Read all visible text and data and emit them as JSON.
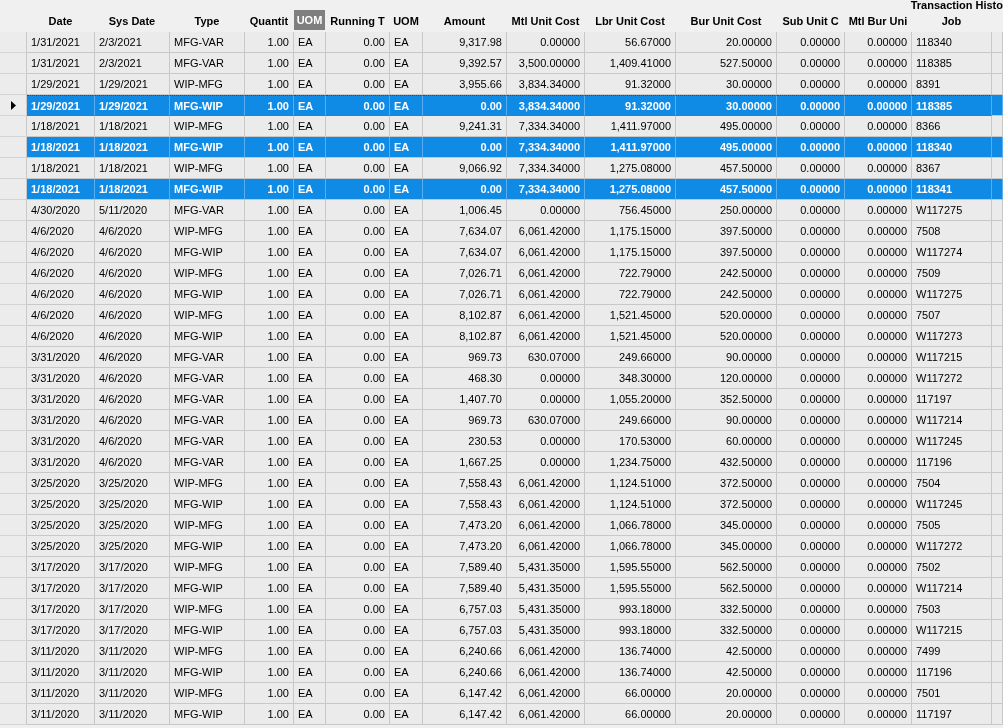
{
  "title": "Transaction Histo",
  "columns": [
    {
      "label": "Date",
      "highlighted": false
    },
    {
      "label": "Sys Date",
      "highlighted": false
    },
    {
      "label": "Type",
      "highlighted": false
    },
    {
      "label": "Quantit",
      "highlighted": false
    },
    {
      "label": "UOM",
      "highlighted": true
    },
    {
      "label": "Running T",
      "highlighted": false
    },
    {
      "label": "UOM",
      "highlighted": false
    },
    {
      "label": "Amount",
      "highlighted": false
    },
    {
      "label": "Mtl Unit Cost",
      "highlighted": false
    },
    {
      "label": "Lbr Unit Cost",
      "highlighted": false
    },
    {
      "label": "Bur Unit Cost",
      "highlighted": false
    },
    {
      "label": "Sub Unit C",
      "highlighted": false
    },
    {
      "label": "Mtl Bur Uni",
      "highlighted": false
    },
    {
      "label": "Job",
      "highlighted": false
    }
  ],
  "rows": [
    {
      "current": false,
      "selected": false,
      "cells": [
        "1/31/2021",
        "2/3/2021",
        "MFG-VAR",
        "1.00",
        "EA",
        "0.00",
        "EA",
        "9,317.98",
        "0.00000",
        "56.67000",
        "20.00000",
        "0.00000",
        "0.00000",
        "118340"
      ]
    },
    {
      "current": false,
      "selected": false,
      "cells": [
        "1/31/2021",
        "2/3/2021",
        "MFG-VAR",
        "1.00",
        "EA",
        "0.00",
        "EA",
        "9,392.57",
        "3,500.00000",
        "1,409.41000",
        "527.50000",
        "0.00000",
        "0.00000",
        "118385"
      ]
    },
    {
      "current": false,
      "selected": false,
      "cells": [
        "1/29/2021",
        "1/29/2021",
        "WIP-MFG",
        "1.00",
        "EA",
        "0.00",
        "EA",
        "3,955.66",
        "3,834.34000",
        "91.32000",
        "30.00000",
        "0.00000",
        "0.00000",
        "8391"
      ]
    },
    {
      "current": true,
      "selected": true,
      "cells": [
        "1/29/2021",
        "1/29/2021",
        "MFG-WIP",
        "1.00",
        "EA",
        "0.00",
        "EA",
        "0.00",
        "3,834.34000",
        "91.32000",
        "30.00000",
        "0.00000",
        "0.00000",
        "118385"
      ]
    },
    {
      "current": false,
      "selected": false,
      "cells": [
        "1/18/2021",
        "1/18/2021",
        "WIP-MFG",
        "1.00",
        "EA",
        "0.00",
        "EA",
        "9,241.31",
        "7,334.34000",
        "1,411.97000",
        "495.00000",
        "0.00000",
        "0.00000",
        "8366"
      ]
    },
    {
      "current": false,
      "selected": true,
      "cells": [
        "1/18/2021",
        "1/18/2021",
        "MFG-WIP",
        "1.00",
        "EA",
        "0.00",
        "EA",
        "0.00",
        "7,334.34000",
        "1,411.97000",
        "495.00000",
        "0.00000",
        "0.00000",
        "118340"
      ]
    },
    {
      "current": false,
      "selected": false,
      "cells": [
        "1/18/2021",
        "1/18/2021",
        "WIP-MFG",
        "1.00",
        "EA",
        "0.00",
        "EA",
        "9,066.92",
        "7,334.34000",
        "1,275.08000",
        "457.50000",
        "0.00000",
        "0.00000",
        "8367"
      ]
    },
    {
      "current": false,
      "selected": true,
      "cells": [
        "1/18/2021",
        "1/18/2021",
        "MFG-WIP",
        "1.00",
        "EA",
        "0.00",
        "EA",
        "0.00",
        "7,334.34000",
        "1,275.08000",
        "457.50000",
        "0.00000",
        "0.00000",
        "118341"
      ]
    },
    {
      "current": false,
      "selected": false,
      "cells": [
        "4/30/2020",
        "5/11/2020",
        "MFG-VAR",
        "1.00",
        "EA",
        "0.00",
        "EA",
        "1,006.45",
        "0.00000",
        "756.45000",
        "250.00000",
        "0.00000",
        "0.00000",
        "W117275"
      ]
    },
    {
      "current": false,
      "selected": false,
      "cells": [
        "4/6/2020",
        "4/6/2020",
        "WIP-MFG",
        "1.00",
        "EA",
        "0.00",
        "EA",
        "7,634.07",
        "6,061.42000",
        "1,175.15000",
        "397.50000",
        "0.00000",
        "0.00000",
        "7508"
      ]
    },
    {
      "current": false,
      "selected": false,
      "cells": [
        "4/6/2020",
        "4/6/2020",
        "MFG-WIP",
        "1.00",
        "EA",
        "0.00",
        "EA",
        "7,634.07",
        "6,061.42000",
        "1,175.15000",
        "397.50000",
        "0.00000",
        "0.00000",
        "W117274"
      ]
    },
    {
      "current": false,
      "selected": false,
      "cells": [
        "4/6/2020",
        "4/6/2020",
        "WIP-MFG",
        "1.00",
        "EA",
        "0.00",
        "EA",
        "7,026.71",
        "6,061.42000",
        "722.79000",
        "242.50000",
        "0.00000",
        "0.00000",
        "7509"
      ]
    },
    {
      "current": false,
      "selected": false,
      "cells": [
        "4/6/2020",
        "4/6/2020",
        "MFG-WIP",
        "1.00",
        "EA",
        "0.00",
        "EA",
        "7,026.71",
        "6,061.42000",
        "722.79000",
        "242.50000",
        "0.00000",
        "0.00000",
        "W117275"
      ]
    },
    {
      "current": false,
      "selected": false,
      "cells": [
        "4/6/2020",
        "4/6/2020",
        "WIP-MFG",
        "1.00",
        "EA",
        "0.00",
        "EA",
        "8,102.87",
        "6,061.42000",
        "1,521.45000",
        "520.00000",
        "0.00000",
        "0.00000",
        "7507"
      ]
    },
    {
      "current": false,
      "selected": false,
      "cells": [
        "4/6/2020",
        "4/6/2020",
        "MFG-WIP",
        "1.00",
        "EA",
        "0.00",
        "EA",
        "8,102.87",
        "6,061.42000",
        "1,521.45000",
        "520.00000",
        "0.00000",
        "0.00000",
        "W117273"
      ]
    },
    {
      "current": false,
      "selected": false,
      "cells": [
        "3/31/2020",
        "4/6/2020",
        "MFG-VAR",
        "1.00",
        "EA",
        "0.00",
        "EA",
        "969.73",
        "630.07000",
        "249.66000",
        "90.00000",
        "0.00000",
        "0.00000",
        "W117215"
      ]
    },
    {
      "current": false,
      "selected": false,
      "cells": [
        "3/31/2020",
        "4/6/2020",
        "MFG-VAR",
        "1.00",
        "EA",
        "0.00",
        "EA",
        "468.30",
        "0.00000",
        "348.30000",
        "120.00000",
        "0.00000",
        "0.00000",
        "W117272"
      ]
    },
    {
      "current": false,
      "selected": false,
      "cells": [
        "3/31/2020",
        "4/6/2020",
        "MFG-VAR",
        "1.00",
        "EA",
        "0.00",
        "EA",
        "1,407.70",
        "0.00000",
        "1,055.20000",
        "352.50000",
        "0.00000",
        "0.00000",
        "117197"
      ]
    },
    {
      "current": false,
      "selected": false,
      "cells": [
        "3/31/2020",
        "4/6/2020",
        "MFG-VAR",
        "1.00",
        "EA",
        "0.00",
        "EA",
        "969.73",
        "630.07000",
        "249.66000",
        "90.00000",
        "0.00000",
        "0.00000",
        "W117214"
      ]
    },
    {
      "current": false,
      "selected": false,
      "cells": [
        "3/31/2020",
        "4/6/2020",
        "MFG-VAR",
        "1.00",
        "EA",
        "0.00",
        "EA",
        "230.53",
        "0.00000",
        "170.53000",
        "60.00000",
        "0.00000",
        "0.00000",
        "W117245"
      ]
    },
    {
      "current": false,
      "selected": false,
      "cells": [
        "3/31/2020",
        "4/6/2020",
        "MFG-VAR",
        "1.00",
        "EA",
        "0.00",
        "EA",
        "1,667.25",
        "0.00000",
        "1,234.75000",
        "432.50000",
        "0.00000",
        "0.00000",
        "117196"
      ]
    },
    {
      "current": false,
      "selected": false,
      "cells": [
        "3/25/2020",
        "3/25/2020",
        "WIP-MFG",
        "1.00",
        "EA",
        "0.00",
        "EA",
        "7,558.43",
        "6,061.42000",
        "1,124.51000",
        "372.50000",
        "0.00000",
        "0.00000",
        "7504"
      ]
    },
    {
      "current": false,
      "selected": false,
      "cells": [
        "3/25/2020",
        "3/25/2020",
        "MFG-WIP",
        "1.00",
        "EA",
        "0.00",
        "EA",
        "7,558.43",
        "6,061.42000",
        "1,124.51000",
        "372.50000",
        "0.00000",
        "0.00000",
        "W117245"
      ]
    },
    {
      "current": false,
      "selected": false,
      "cells": [
        "3/25/2020",
        "3/25/2020",
        "WIP-MFG",
        "1.00",
        "EA",
        "0.00",
        "EA",
        "7,473.20",
        "6,061.42000",
        "1,066.78000",
        "345.00000",
        "0.00000",
        "0.00000",
        "7505"
      ]
    },
    {
      "current": false,
      "selected": false,
      "cells": [
        "3/25/2020",
        "3/25/2020",
        "MFG-WIP",
        "1.00",
        "EA",
        "0.00",
        "EA",
        "7,473.20",
        "6,061.42000",
        "1,066.78000",
        "345.00000",
        "0.00000",
        "0.00000",
        "W117272"
      ]
    },
    {
      "current": false,
      "selected": false,
      "cells": [
        "3/17/2020",
        "3/17/2020",
        "WIP-MFG",
        "1.00",
        "EA",
        "0.00",
        "EA",
        "7,589.40",
        "5,431.35000",
        "1,595.55000",
        "562.50000",
        "0.00000",
        "0.00000",
        "7502"
      ]
    },
    {
      "current": false,
      "selected": false,
      "cells": [
        "3/17/2020",
        "3/17/2020",
        "MFG-WIP",
        "1.00",
        "EA",
        "0.00",
        "EA",
        "7,589.40",
        "5,431.35000",
        "1,595.55000",
        "562.50000",
        "0.00000",
        "0.00000",
        "W117214"
      ]
    },
    {
      "current": false,
      "selected": false,
      "cells": [
        "3/17/2020",
        "3/17/2020",
        "WIP-MFG",
        "1.00",
        "EA",
        "0.00",
        "EA",
        "6,757.03",
        "5,431.35000",
        "993.18000",
        "332.50000",
        "0.00000",
        "0.00000",
        "7503"
      ]
    },
    {
      "current": false,
      "selected": false,
      "cells": [
        "3/17/2020",
        "3/17/2020",
        "MFG-WIP",
        "1.00",
        "EA",
        "0.00",
        "EA",
        "6,757.03",
        "5,431.35000",
        "993.18000",
        "332.50000",
        "0.00000",
        "0.00000",
        "W117215"
      ]
    },
    {
      "current": false,
      "selected": false,
      "cells": [
        "3/11/2020",
        "3/11/2020",
        "WIP-MFG",
        "1.00",
        "EA",
        "0.00",
        "EA",
        "6,240.66",
        "6,061.42000",
        "136.74000",
        "42.50000",
        "0.00000",
        "0.00000",
        "7499"
      ]
    },
    {
      "current": false,
      "selected": false,
      "cells": [
        "3/11/2020",
        "3/11/2020",
        "MFG-WIP",
        "1.00",
        "EA",
        "0.00",
        "EA",
        "6,240.66",
        "6,061.42000",
        "136.74000",
        "42.50000",
        "0.00000",
        "0.00000",
        "117196"
      ]
    },
    {
      "current": false,
      "selected": false,
      "cells": [
        "3/11/2020",
        "3/11/2020",
        "WIP-MFG",
        "1.00",
        "EA",
        "0.00",
        "EA",
        "6,147.42",
        "6,061.42000",
        "66.00000",
        "20.00000",
        "0.00000",
        "0.00000",
        "7501"
      ]
    },
    {
      "current": false,
      "selected": false,
      "cells": [
        "3/11/2020",
        "3/11/2020",
        "MFG-WIP",
        "1.00",
        "EA",
        "0.00",
        "EA",
        "6,147.42",
        "6,061.42000",
        "66.00000",
        "20.00000",
        "0.00000",
        "0.00000",
        "117197"
      ]
    }
  ]
}
